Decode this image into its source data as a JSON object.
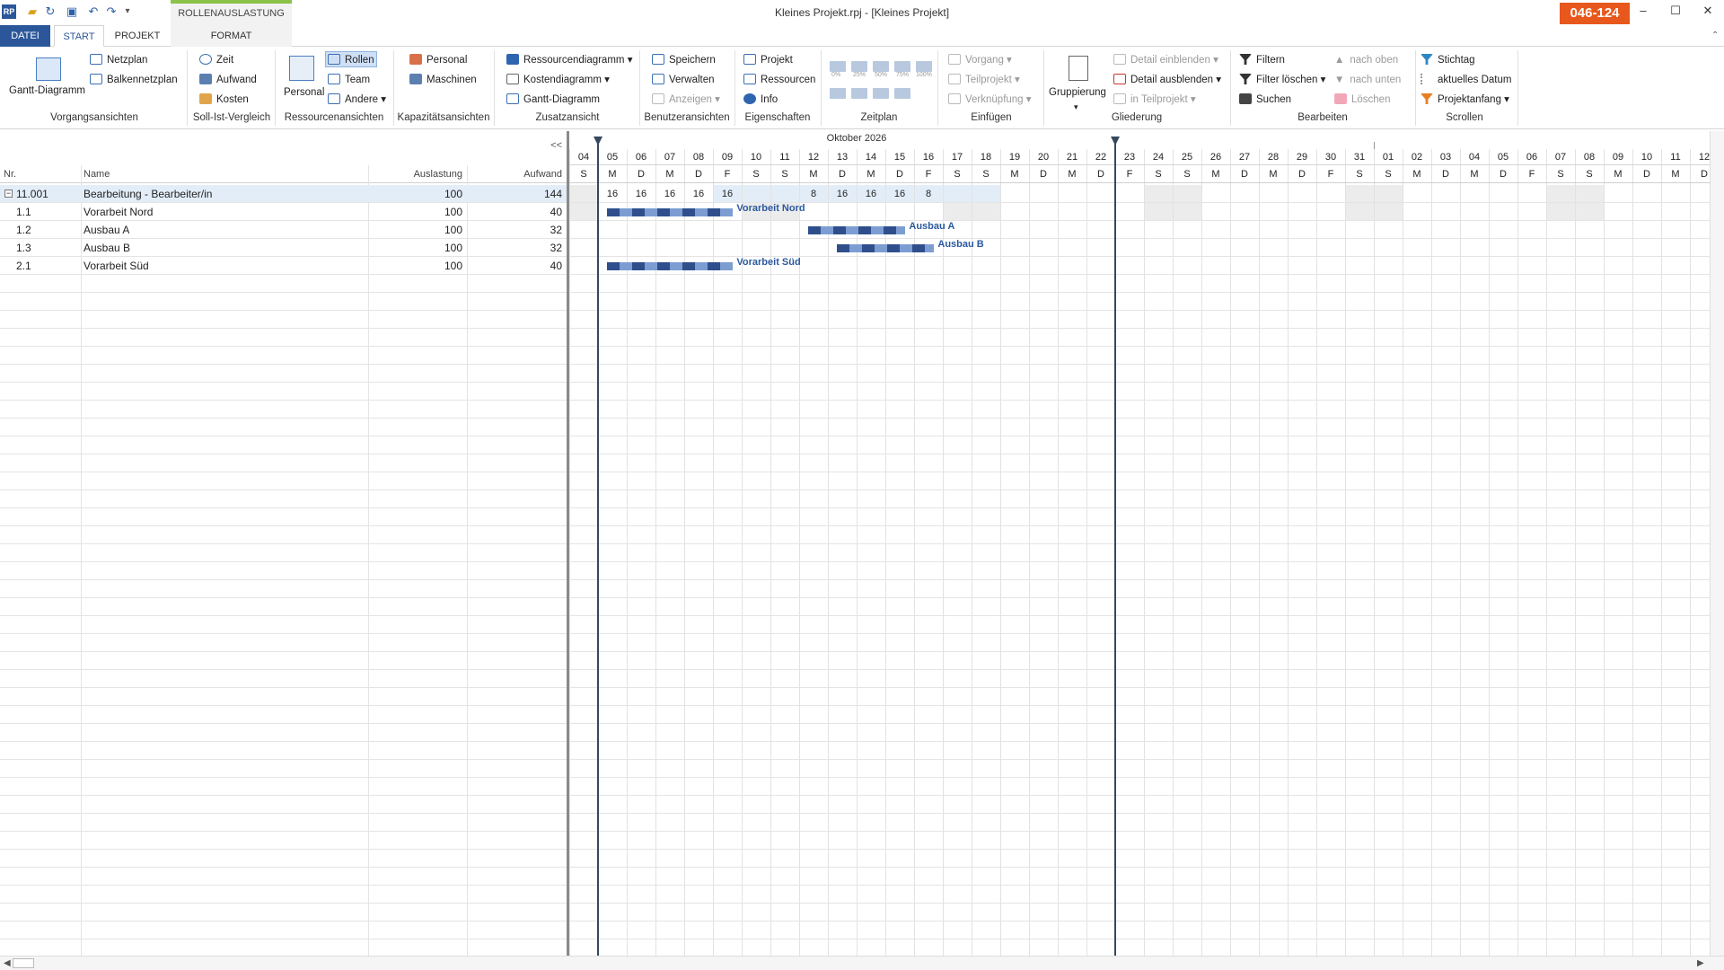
{
  "window": {
    "title": "Kleines Projekt.rpj - [Kleines Projekt]",
    "context_tab": "ROLLENAUSLASTUNG",
    "badge": "046-124",
    "minimize": "–",
    "restore": "☐",
    "close": "✕"
  },
  "tabs": [
    {
      "label": "DATEI"
    },
    {
      "label": "START"
    },
    {
      "label": "PROJEKT"
    },
    {
      "label": "FORMAT"
    }
  ],
  "ribbon": {
    "vorgangsansichten": {
      "label": "Vorgangsansichten",
      "gantt": "Gantt-Diagramm",
      "netzplan": "Netzplan",
      "balkennetzplan": "Balkennetzplan"
    },
    "soll_ist": {
      "label": "Soll-Ist-Vergleich",
      "zeit": "Zeit",
      "aufwand": "Aufwand",
      "kosten": "Kosten"
    },
    "ressourcenansichten": {
      "label": "Ressourcenansichten",
      "personal": "Personal",
      "rollen": "Rollen",
      "team": "Team",
      "andere": "Andere"
    },
    "kapazitaet": {
      "label": "Kapazitätsansichten",
      "personal": "Personal",
      "maschinen": "Maschinen"
    },
    "zusatz": {
      "label": "Zusatzansicht",
      "ressourcendiagramm": "Ressourcendiagramm",
      "kostendiagramm": "Kostendiagramm",
      "gantt": "Gantt-Diagramm"
    },
    "benutzer": {
      "label": "Benutzeransichten",
      "speichern": "Speichern",
      "verwalten": "Verwalten",
      "anzeigen": "Anzeigen"
    },
    "eigenschaften": {
      "label": "Eigenschaften",
      "projekt": "Projekt",
      "ressourcen": "Ressourcen",
      "info": "Info"
    },
    "zeitplan": {
      "label": "Zeitplan",
      "pct": [
        "0%",
        "25%",
        "50%",
        "75%",
        "100%"
      ]
    },
    "einfuegen": {
      "label": "Einfügen",
      "vorgang": "Vorgang",
      "teilprojekt": "Teilprojekt",
      "verknuepfung": "Verknüpfung"
    },
    "gliederung": {
      "label": "Gliederung",
      "gruppierung": "Gruppierung",
      "detail_ein": "Detail einblenden",
      "detail_aus": "Detail ausblenden",
      "in_teilprojekt": "in Teilprojekt"
    },
    "bearbeiten": {
      "label": "Bearbeiten",
      "filtern": "Filtern",
      "filter_loeschen": "Filter löschen",
      "suchen": "Suchen",
      "nach_oben": "nach oben",
      "nach_unten": "nach unten",
      "loeschen": "Löschen"
    },
    "scrollen": {
      "label": "Scrollen",
      "stichtag": "Stichtag",
      "aktuelles_datum": "aktuelles Datum",
      "projektanfang": "Projektanfang"
    }
  },
  "table": {
    "headers": {
      "nr": "Nr.",
      "name": "Name",
      "auslastung": "Auslastung",
      "aufwand": "Aufwand"
    },
    "rows": [
      {
        "nr": "11.001",
        "name": "Bearbeitung - Bearbeiter/in",
        "auslastung": "100",
        "aufwand": "144",
        "group": true
      },
      {
        "nr": "1.1",
        "name": "Vorarbeit Nord",
        "auslastung": "100",
        "aufwand": "40"
      },
      {
        "nr": "1.2",
        "name": "Ausbau A",
        "auslastung": "100",
        "aufwand": "32"
      },
      {
        "nr": "1.3",
        "name": "Ausbau B",
        "auslastung": "100",
        "aufwand": "32"
      },
      {
        "nr": "2.1",
        "name": "Vorarbeit Süd",
        "auslastung": "100",
        "aufwand": "40"
      }
    ],
    "collapse": "<<",
    "expander": "−"
  },
  "gantt": {
    "month": "Oktober 2026",
    "days": [
      "04",
      "05",
      "06",
      "07",
      "08",
      "09",
      "10",
      "11",
      "12",
      "13",
      "14",
      "15",
      "16",
      "17",
      "18",
      "19",
      "20",
      "21",
      "22",
      "23",
      "24",
      "25",
      "26",
      "27",
      "28",
      "29",
      "30",
      "31",
      "01",
      "02",
      "03",
      "04",
      "05",
      "06",
      "07",
      "08",
      "09",
      "10",
      "11",
      "12"
    ],
    "weekdays": [
      "S",
      "M",
      "D",
      "M",
      "D",
      "F",
      "S",
      "S",
      "M",
      "D",
      "M",
      "D",
      "F",
      "S",
      "S",
      "M",
      "D",
      "M",
      "D",
      "F",
      "S",
      "S",
      "M",
      "D",
      "M",
      "D",
      "F",
      "S",
      "S",
      "M",
      "D",
      "M",
      "D",
      "F",
      "S",
      "S",
      "M",
      "D",
      "M",
      "D"
    ],
    "weekend_days": [
      0,
      6,
      7,
      13,
      14,
      20,
      21,
      27,
      28,
      34,
      35
    ],
    "highlight_days": [
      5,
      6,
      7,
      8,
      9,
      10,
      11,
      12,
      13,
      14
    ],
    "load_values": [
      "",
      "16",
      "16",
      "16",
      "16",
      "16",
      "",
      "",
      "8",
      "16",
      "16",
      "16",
      "8"
    ],
    "project_start_day": 1,
    "project_end_day": 19,
    "bars": [
      {
        "row": 1,
        "start_day": 1.3,
        "end_day": 5.7,
        "label": "Vorarbeit Nord"
      },
      {
        "row": 2,
        "start_day": 8.3,
        "end_day": 11.7,
        "label": "Ausbau A"
      },
      {
        "row": 3,
        "start_day": 9.3,
        "end_day": 12.7,
        "label": "Ausbau B"
      },
      {
        "row": 4,
        "start_day": 1.3,
        "end_day": 5.7,
        "label": "Vorarbeit Süd"
      }
    ]
  }
}
